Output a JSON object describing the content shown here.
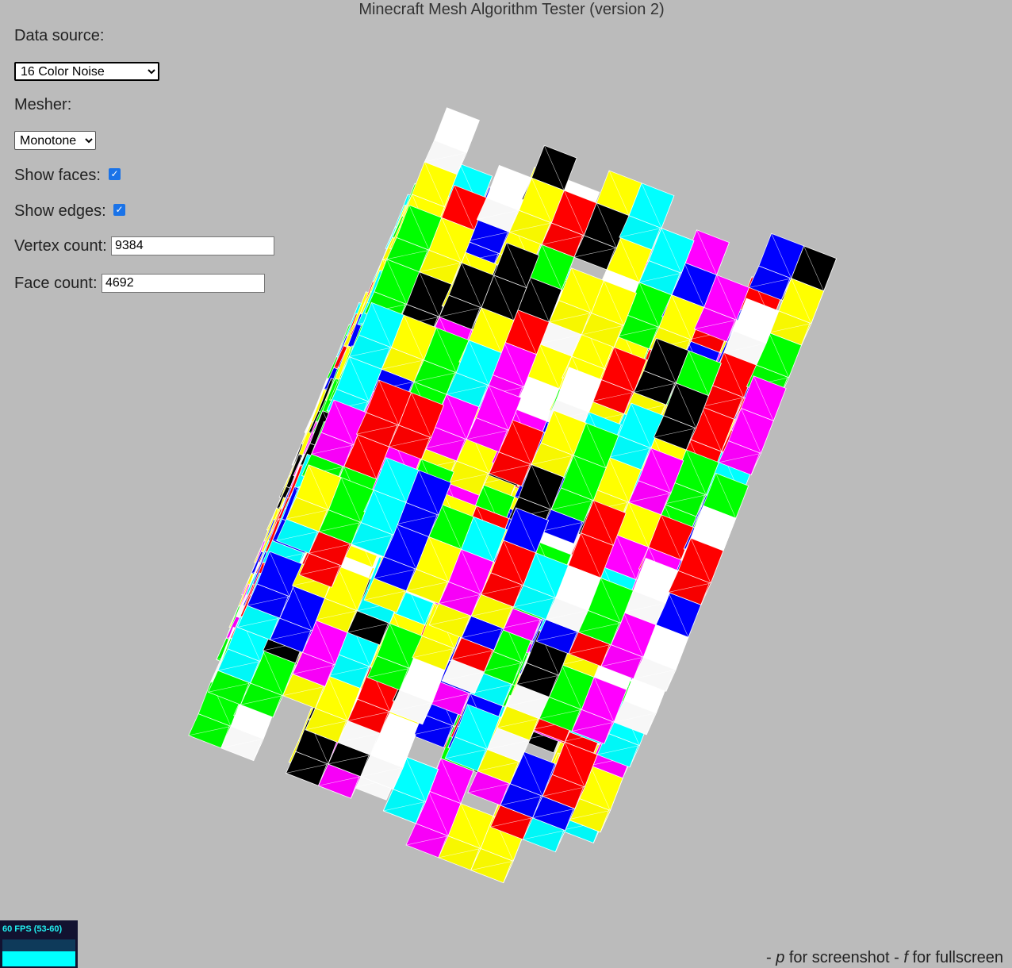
{
  "title": "Minecraft Mesh Algorithm Tester (version 2)",
  "controls": {
    "data_source_label": "Data source:",
    "data_source_value": "16 Color Noise",
    "mesher_label": "Mesher:",
    "mesher_value": "Monotone",
    "show_faces_label": "Show faces:",
    "show_faces_checked": true,
    "show_edges_label": "Show edges:",
    "show_edges_checked": true,
    "vertex_count_label": "Vertex count:",
    "vertex_count": "9384",
    "face_count_label": "Face count:",
    "face_count": "4692"
  },
  "stats": {
    "fps_text": "60 FPS (53-60)",
    "fps_fill_fraction": 0.55
  },
  "footer": {
    "p1": "- ",
    "key_p": "p",
    "p2": " for screenshot - ",
    "key_f": "f",
    "p3": " for fullscreen"
  },
  "palette": {
    "red": "#ff0000",
    "yellow": "#ffff00",
    "green": "#00ff00",
    "cyan": "#00ffff",
    "blue": "#0000ff",
    "magenta": "#ff00ff",
    "white": "#ffffff",
    "black": "#000000",
    "background": "#bbbbbb"
  }
}
